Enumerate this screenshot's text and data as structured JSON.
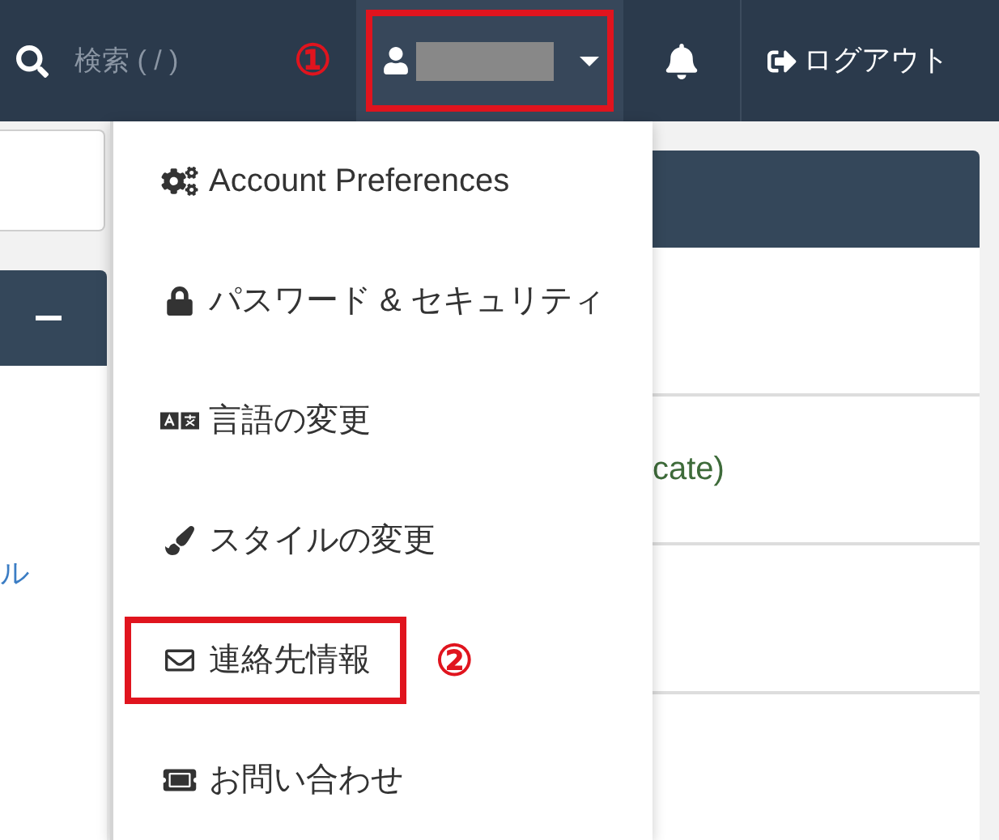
{
  "navbar": {
    "search": {
      "placeholder": "検索 ( / )"
    },
    "user_menu": {
      "highlighted": true,
      "marker": "①",
      "expanded": true
    },
    "logout": "ログアウト"
  },
  "left_panel": {
    "link_fragment": "ル"
  },
  "right_panel": {
    "rows": [
      {
        "text": ""
      },
      {
        "text": "cate)"
      },
      {
        "text": ""
      },
      {
        "text": ""
      }
    ]
  },
  "dropdown": {
    "items": [
      {
        "label": "Account Preferences",
        "highlighted": false
      },
      {
        "label": "パスワード & セキュリティ",
        "highlighted": false
      },
      {
        "label": "言語の変更",
        "highlighted": false
      },
      {
        "label": "スタイルの変更",
        "highlighted": false
      },
      {
        "label": "連絡先情報",
        "highlighted": true,
        "marker": "②"
      },
      {
        "label": "お問い合わせ",
        "highlighted": false
      }
    ]
  }
}
